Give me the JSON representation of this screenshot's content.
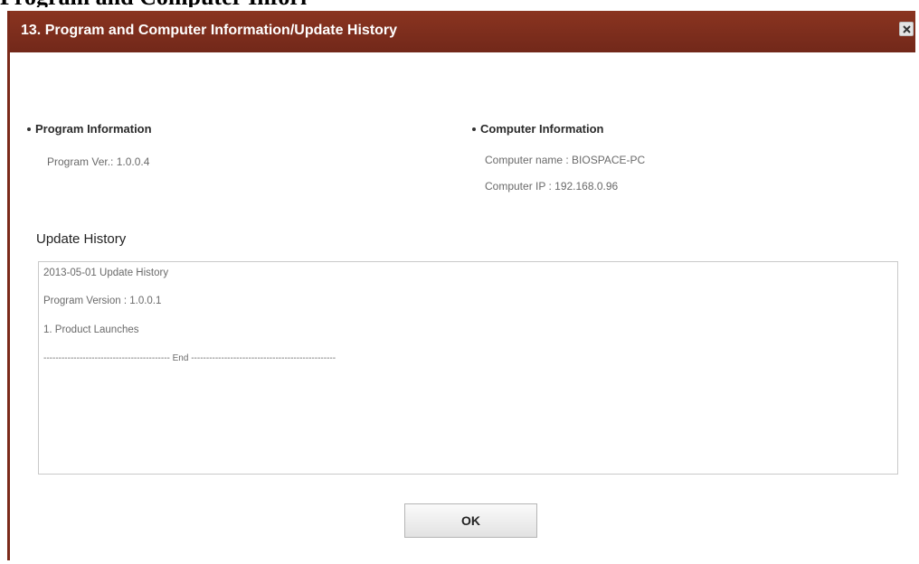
{
  "page_heading_fragment": "Program and Computer Information/Update History",
  "dialog": {
    "title": "13. Program and Computer Information/Update History",
    "close_icon": "close-icon"
  },
  "program_info": {
    "heading": "Program Information",
    "version_line": "Program Ver.: 1.0.0.4"
  },
  "computer_info": {
    "heading": "Computer Information",
    "name_line": "Computer name : BIOSPACE-PC",
    "ip_line": "Computer IP : 192.168.0.96"
  },
  "update_history": {
    "heading": "Update History",
    "lines": [
      "2013-05-01 Update History",
      "Program Version : 1.0.0.1",
      "1. Product Launches",
      "------------------------------------------ End ------------------------------------------------"
    ]
  },
  "ok_button_label": "OK",
  "colors": {
    "title_bar": "#7d2d17",
    "title_text": "#ffffff"
  }
}
